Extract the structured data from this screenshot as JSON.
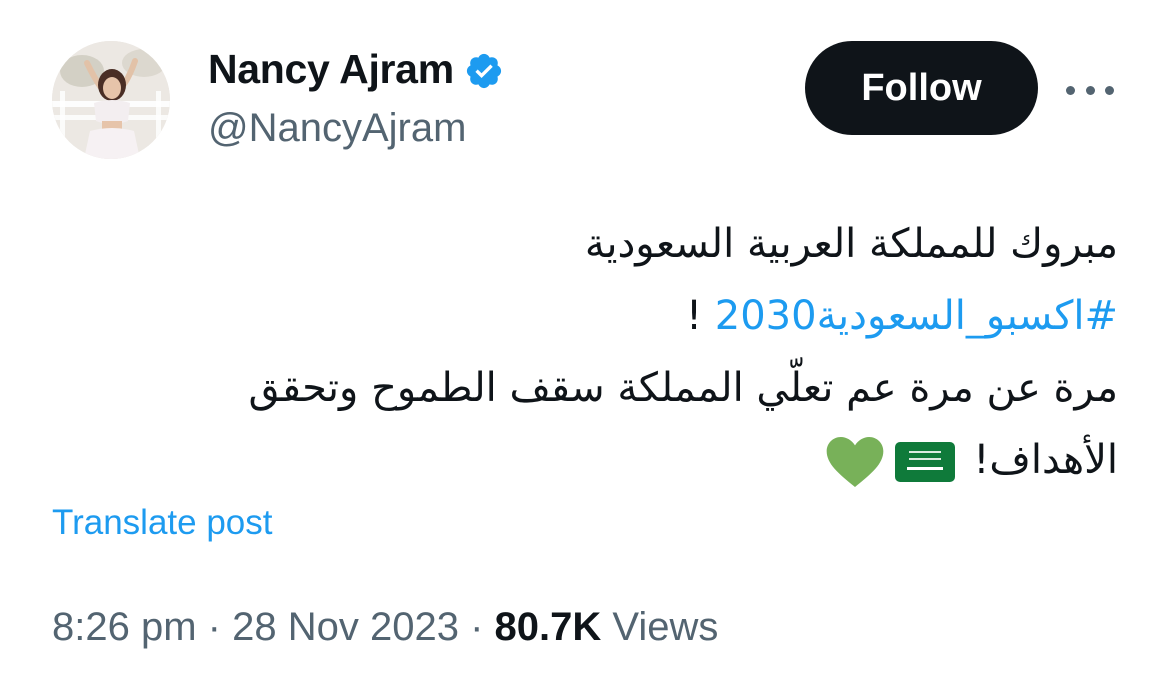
{
  "author": {
    "display_name": "Nancy Ajram",
    "handle": "@NancyAjram",
    "verified": true,
    "avatar_icon": "profile-photo"
  },
  "actions": {
    "follow_label": "Follow",
    "more_icon": "ellipsis-icon"
  },
  "tweet": {
    "line1": "مبروك للمملكة العربية السعودية",
    "hashtag": "#اكسبو_السعودية2030",
    "line2_suffix": " !",
    "line3": "مرة عن مرة عم تعلّي المملكة سقف الطموح وتحقق",
    "line4": "الأهداف!",
    "emojis": [
      "saudi-flag",
      "green-heart"
    ]
  },
  "translate_label": "Translate post",
  "meta": {
    "time": "8:26 pm",
    "separator": "·",
    "date": "28 Nov 2023",
    "views_count": "80.7K",
    "views_label": "Views"
  },
  "colors": {
    "link": "#1d9bf0",
    "text": "#0f1419",
    "secondary": "#536471",
    "verified_badge": "#1d9bf0",
    "follow_bg": "#0f1419",
    "heart": "#78b159",
    "flag": "#0f7a3a"
  }
}
